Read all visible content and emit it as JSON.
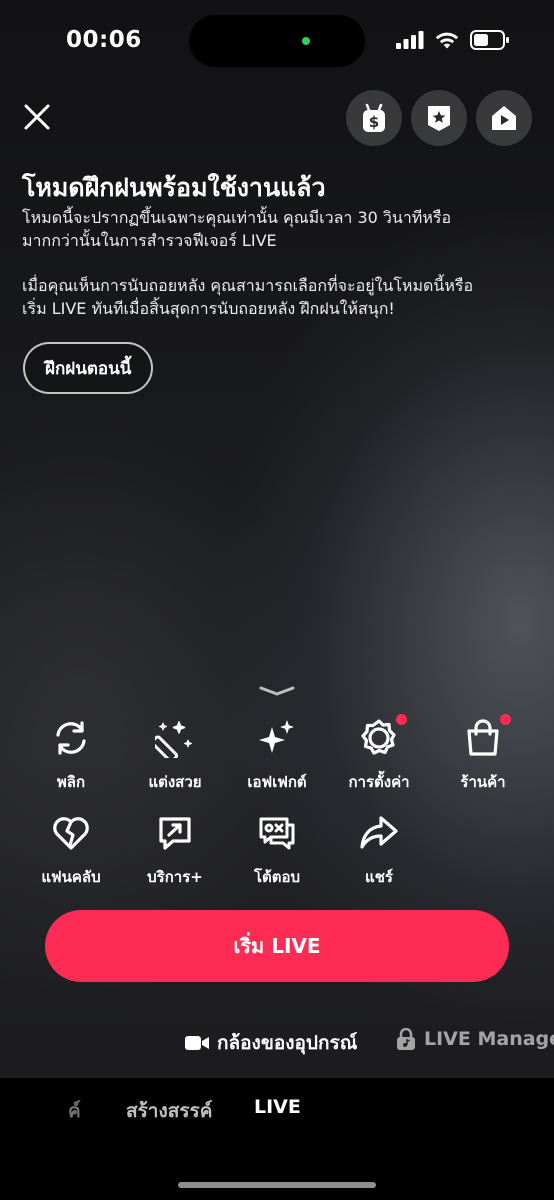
{
  "status_bar": {
    "time": "00:06"
  },
  "header": {
    "close_icon": "close-icon",
    "buttons": [
      "gift-money-icon",
      "ranking-badge-icon",
      "live-home-icon"
    ]
  },
  "practice": {
    "title": "โหมดฝึกฝนพร้อมใช้งานแล้ว",
    "desc1_line1": "โหมดนี้จะปรากฏขึ้นเฉพาะคุณเท่านั้น คุณมีเวลา 30 วินาทีหรือ",
    "desc1_line2": "มากกว่านั้นในการสำรวจฟีเจอร์ LIVE",
    "desc2_line1": "เมื่อคุณเห็นการนับถอยหลัง คุณสามารถเลือกที่จะอยู่ในโหมดนี้หรือ",
    "desc2_line2": "เริ่ม LIVE ทันทีเมื่อสิ้นสุดการนับถอยหลัง ฝึกฝนให้สนุก!",
    "button": "ฝึกฝนตอนนี้"
  },
  "tools": [
    {
      "label": "พลิก",
      "icon": "flip-camera-icon",
      "badge": false
    },
    {
      "label": "แต่งสวย",
      "icon": "beauty-wand-icon",
      "badge": false
    },
    {
      "label": "เอฟเฟกต์",
      "icon": "effects-sparkle-icon",
      "badge": false
    },
    {
      "label": "การตั้งค่า",
      "icon": "settings-gear-icon",
      "badge": true
    },
    {
      "label": "ร้านค้า",
      "icon": "shopping-bag-icon",
      "badge": true
    },
    {
      "label": "แฟนคลับ",
      "icon": "fan-club-heart-icon",
      "badge": false
    },
    {
      "label": "บริการ+",
      "icon": "services-plus-icon",
      "badge": false
    },
    {
      "label": "โต้ตอบ",
      "icon": "interact-chat-icon",
      "badge": false
    },
    {
      "label": "แชร์",
      "icon": "share-arrow-icon",
      "badge": false
    }
  ],
  "go_live": {
    "label": "เริ่ม LIVE"
  },
  "source": {
    "camera_label": "กล้องของอุปกรณ์",
    "manager_label": "LIVE Manage"
  },
  "modes": {
    "partial": "ค์",
    "create": "สร้างสรรค์",
    "live": "LIVE"
  },
  "colors": {
    "accent": "#fe2c55",
    "island_dot": "#30d158"
  }
}
